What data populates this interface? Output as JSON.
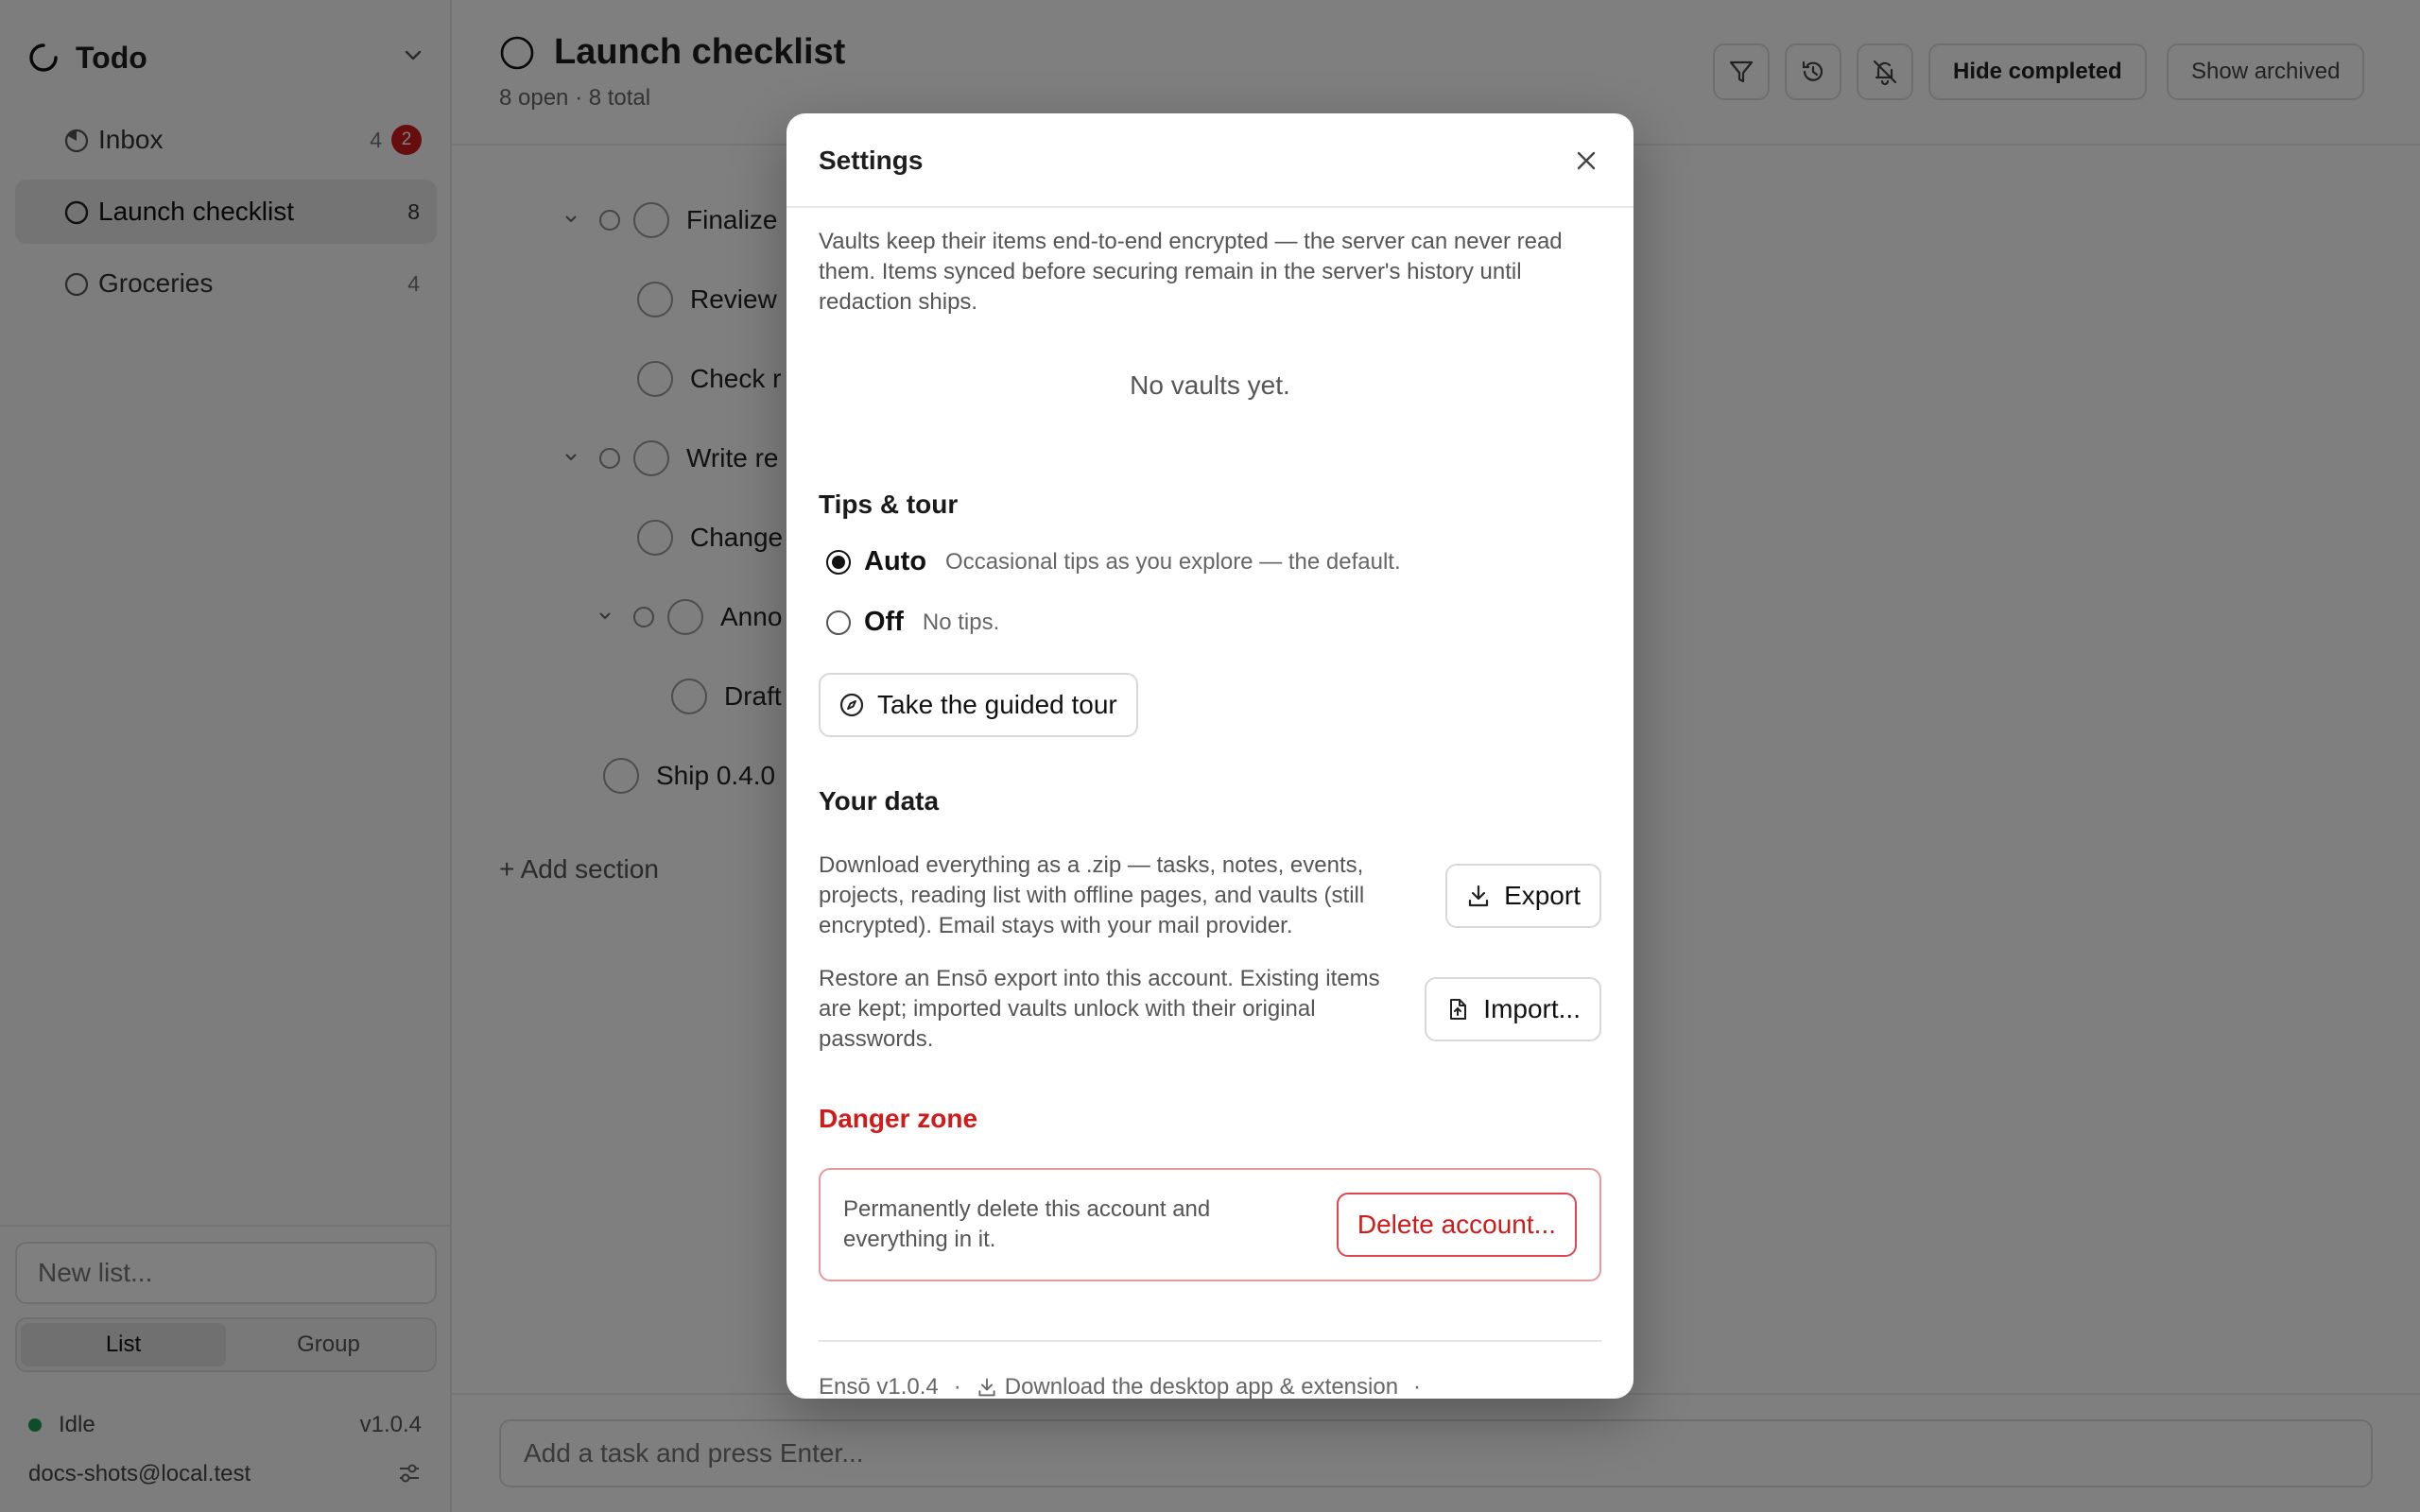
{
  "sidebar": {
    "title": "Todo",
    "items": [
      {
        "label": "Inbox",
        "count": "4",
        "badge": "2"
      },
      {
        "label": "Launch checklist",
        "count": "8"
      },
      {
        "label": "Groceries",
        "count": "4"
      }
    ],
    "new_list_placeholder": "New list...",
    "segment": [
      "List",
      "Group"
    ],
    "status": "Idle",
    "version": "v1.0.4",
    "user": "docs-shots@local.test"
  },
  "main": {
    "title": "Launch checklist",
    "subtitle": "8 open · 8 total",
    "buttons": {
      "hide_completed": "Hide completed",
      "show_archived": "Show archived"
    },
    "tasks": [
      "Finalize",
      "Review",
      "Check r",
      "Write re",
      "Change",
      "Anno",
      "Draft",
      "Ship 0.4.0"
    ],
    "add_section": "+ Add section",
    "add_task_placeholder": "Add a task and press Enter..."
  },
  "modal": {
    "title": "Settings",
    "vaults_text": "Vaults keep their items end-to-end encrypted — the server can never read them. Items synced before securing remain in the server's history until redaction ships.",
    "vaults_empty": "No vaults yet.",
    "tips_heading": "Tips & tour",
    "tips_options": [
      {
        "label": "Auto",
        "desc": "Occasional tips as you explore — the default.",
        "selected": true
      },
      {
        "label": "Off",
        "desc": "No tips.",
        "selected": false
      }
    ],
    "tour_button": "Take the guided tour",
    "data_heading": "Your data",
    "export_text": "Download everything as a .zip — tasks, notes, events, projects, reading list with offline pages, and vaults (still encrypted). Email stays with your mail provider.",
    "export_button": "Export",
    "import_text": "Restore an Ensō export into this account. Existing items are kept; imported vaults unlock with their original passwords.",
    "import_button": "Import...",
    "danger_heading": "Danger zone",
    "danger_text": "Permanently delete this account and everything in it.",
    "delete_button": "Delete account...",
    "footer_version": "Ensō v1.0.4",
    "footer_download": "Download the desktop app & extension",
    "footer_sep": "·"
  },
  "colors": {
    "danger": "#d11a1a",
    "status_ok": "#1f9a54",
    "overlay": "rgba(0,0,0,0.5)"
  }
}
